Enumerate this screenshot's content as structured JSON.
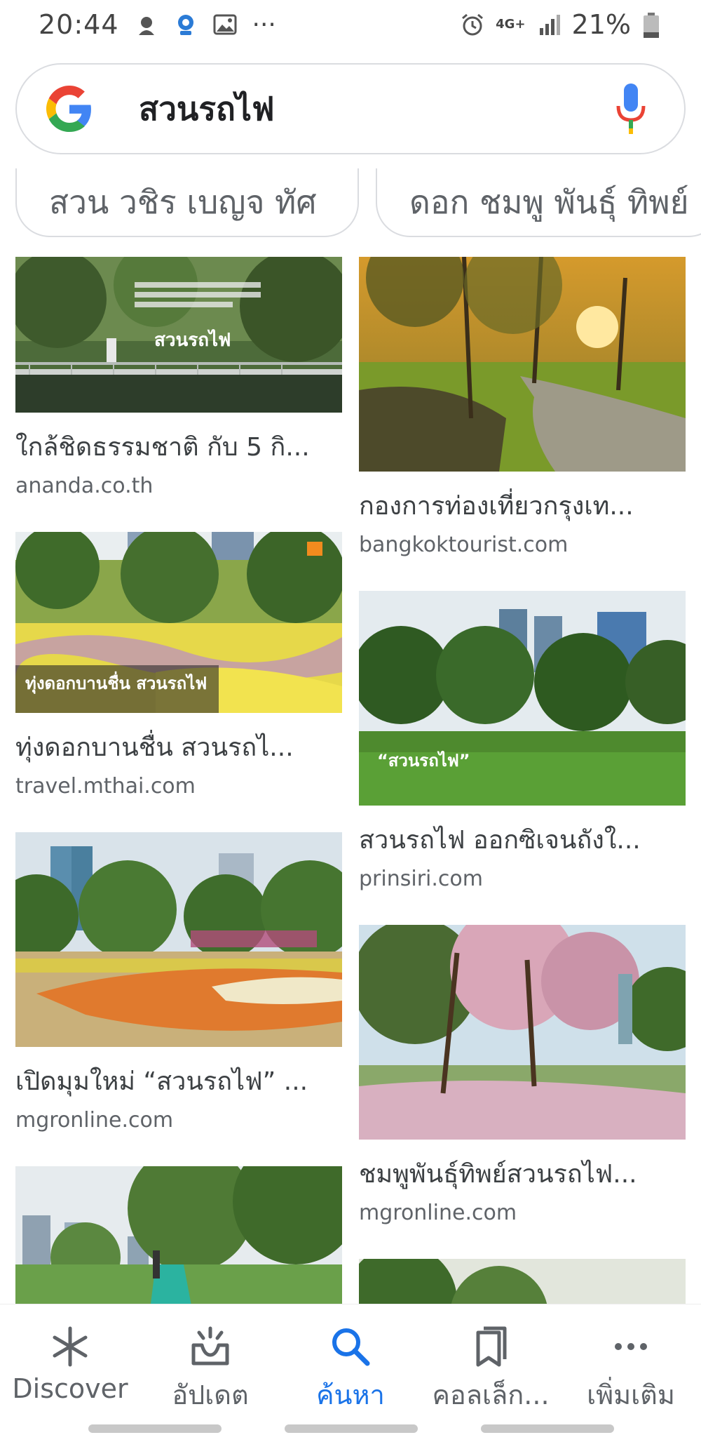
{
  "status_bar": {
    "time": "20:44",
    "network": "4G+",
    "battery": "21%",
    "more": "···"
  },
  "search": {
    "query": "สวนรถไฟ"
  },
  "chips": [
    {
      "label": "สวน วชิร เบญจ ทัศ"
    },
    {
      "label": "ดอก ชมพู พันธุ์ ทิพย์"
    }
  ],
  "results": {
    "left": [
      {
        "title": "ใกล้ชิดธรรมชาติ กับ 5 กิ...",
        "source": "ananda.co.th",
        "overlay": "สวนรถไฟ"
      },
      {
        "title": "ทุ่งดอกบานชื่น สวนรถไ...",
        "source": "travel.mthai.com",
        "overlay": "ทุ่งดอกบานชื่น สวนรถไฟ"
      },
      {
        "title": "เปิดมุมใหม่ “สวนรถไฟ” ...",
        "source": "mgronline.com"
      },
      {
        "title": "",
        "source": ""
      }
    ],
    "right": [
      {
        "title": "กองการท่องเที่ยวกรุงเท...",
        "source": "bangkoktourist.com"
      },
      {
        "title": "สวนรถไฟ ออกซิเจนถังใ...",
        "source": "prinsiri.com",
        "overlay": "“สวนรถไฟ”"
      },
      {
        "title": "ชมพูพันธุ์ทิพย์สวนรถไฟ...",
        "source": "mgronline.com"
      },
      {
        "title": "",
        "source": ""
      }
    ]
  },
  "bottom_nav": [
    {
      "label": "Discover",
      "icon": "asterisk-icon",
      "active": false
    },
    {
      "label": "อัปเดต",
      "icon": "updates-icon",
      "active": false
    },
    {
      "label": "ค้นหา",
      "icon": "search-icon",
      "active": true
    },
    {
      "label": "คอลเล็ก...",
      "icon": "collections-icon",
      "active": false
    },
    {
      "label": "เพิ่มเติม",
      "icon": "more-icon",
      "active": false
    }
  ],
  "colors": {
    "accent": "#1a73e8",
    "text": "#3c4043",
    "muted": "#5f6368",
    "border": "#dadce0"
  }
}
